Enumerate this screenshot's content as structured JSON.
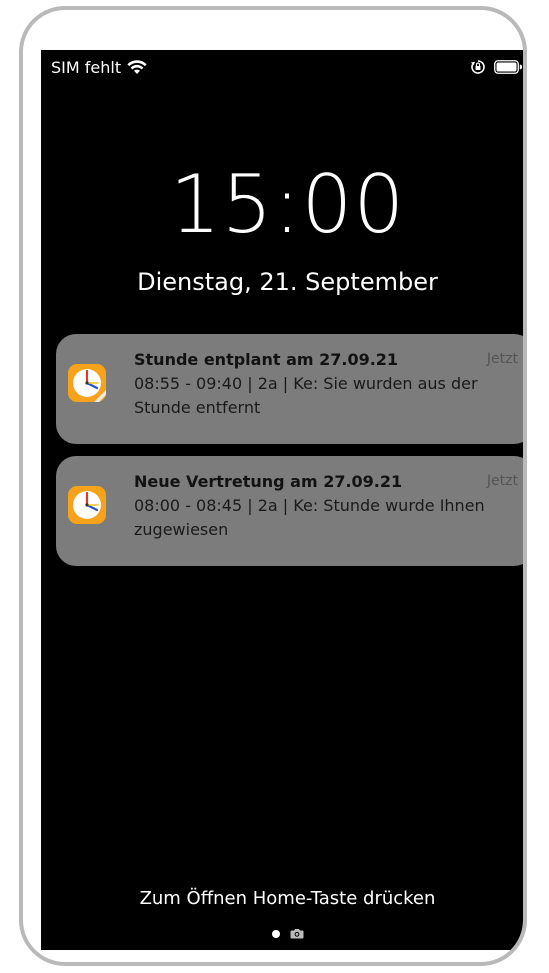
{
  "status_bar": {
    "carrier": "SIM fehlt",
    "wifi_icon": "wifi-icon",
    "orientation_lock_icon": "orientation-lock-icon",
    "battery_icon": "battery-icon"
  },
  "lock_screen": {
    "time": "15:00",
    "date": "Dienstag, 21. September",
    "unlock_hint": "Zum Öffnen Home-Taste drücken"
  },
  "notifications": [
    {
      "app_icon": "clock-app-icon",
      "title": "Stunde entplant am 27.09.21",
      "time": "Jetzt",
      "body": "08:55 - 09:40 | 2a | Ke: Sie wurden aus der Stunde entfernt"
    },
    {
      "app_icon": "clock-app-icon",
      "title": "Neue Vertretung am 27.09.21",
      "time": "Jetzt",
      "body": "08:00 - 08:45 | 2a | Ke: Stunde wurde Ihnen zugewiesen"
    }
  ],
  "page_indicator": {
    "items": [
      "dot",
      "camera-icon"
    ]
  },
  "colors": {
    "screen_background": "#000000",
    "notification_background": "#7c7c7c",
    "icon_orange": "#f6a21a",
    "device_frame": "#b9b9b9"
  }
}
